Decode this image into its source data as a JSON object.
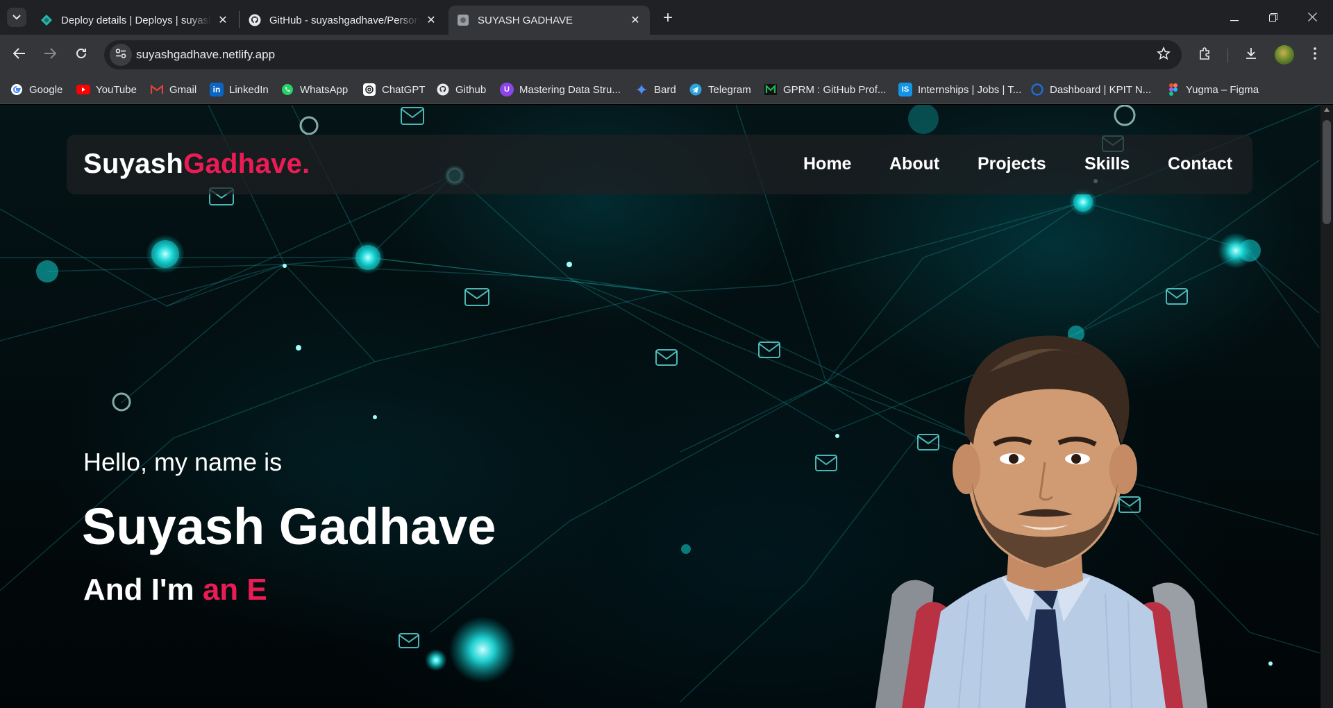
{
  "browser": {
    "tabs": [
      {
        "title": "Deploy details | Deploys | suyashgadhave",
        "active": false,
        "favicon": "netlify-icon"
      },
      {
        "title": "GitHub - suyashgadhave/Personal-Portfolio",
        "active": false,
        "favicon": "github-icon"
      },
      {
        "title": "SUYASH GADHAVE",
        "active": true,
        "favicon": "site-icon"
      }
    ],
    "url": "suyashgadhave.netlify.app",
    "bookmarks": [
      {
        "label": "Google",
        "icon": "google-icon",
        "color": "#4285f4"
      },
      {
        "label": "YouTube",
        "icon": "youtube-icon",
        "color": "#ff0000"
      },
      {
        "label": "Gmail",
        "icon": "gmail-icon",
        "color": "#ea4335"
      },
      {
        "label": "LinkedIn",
        "icon": "linkedin-icon",
        "color": "#0a66c2"
      },
      {
        "label": "WhatsApp",
        "icon": "whatsapp-icon",
        "color": "#25d366"
      },
      {
        "label": "ChatGPT",
        "icon": "chatgpt-icon",
        "color": "#ffffff"
      },
      {
        "label": "Github",
        "icon": "github-icon",
        "color": "#ffffff"
      },
      {
        "label": "Mastering Data Stru...",
        "icon": "course-icon",
        "color": "#8e44ec"
      },
      {
        "label": "Bard",
        "icon": "bard-icon",
        "color": "#4f8cf7"
      },
      {
        "label": "Telegram",
        "icon": "telegram-icon",
        "color": "#2aa3df"
      },
      {
        "label": "GPRM : GitHub Prof...",
        "icon": "gprm-icon",
        "color": "#1db954"
      },
      {
        "label": "Internships | Jobs | T...",
        "icon": "internshala-icon",
        "color": "#1295e6"
      },
      {
        "label": "Dashboard | KPIT N...",
        "icon": "kpit-icon",
        "color": "#1a73e8"
      },
      {
        "label": "Yugma – Figma",
        "icon": "figma-icon",
        "color": "#f24e1e"
      }
    ]
  },
  "site": {
    "logo_first": "Suyash",
    "logo_second": "Gadhave.",
    "nav": [
      "Home",
      "About",
      "Projects",
      "Skills",
      "Contact"
    ],
    "hero": {
      "greeting": "Hello, my name is",
      "name": "Suyash Gadhave",
      "role_prefix": "And I'm",
      "role_typed": "an E"
    },
    "accent_color": "#ed1b55"
  }
}
